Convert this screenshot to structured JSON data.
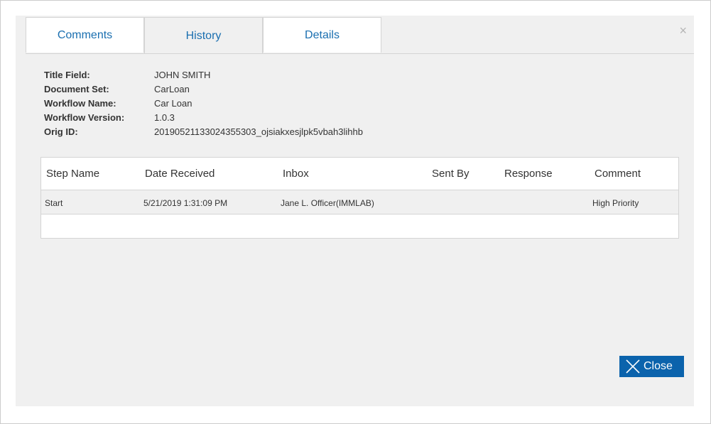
{
  "tabs": [
    {
      "label": "Comments"
    },
    {
      "label": "History"
    },
    {
      "label": "Details"
    }
  ],
  "dialog": {
    "close_symbol": "×",
    "close_button_label": "Close"
  },
  "info": [
    {
      "label": "Title Field:",
      "value": "JOHN SMITH"
    },
    {
      "label": "Document Set:",
      "value": "CarLoan"
    },
    {
      "label": "Workflow Name:",
      "value": "Car Loan"
    },
    {
      "label": "Workflow Version:",
      "value": "1.0.3"
    },
    {
      "label": "Orig ID:",
      "value": "20190521133024355303_ojsiakxesjlpk5vbah3lihhb"
    }
  ],
  "history": {
    "columns": [
      "Step Name",
      "Date Received",
      "Inbox",
      "Sent By",
      "Response",
      "Comment"
    ],
    "rows": [
      {
        "step_name": "Start",
        "date_received": "5/21/2019 1:31:09 PM",
        "inbox": "Jane L. Officer(IMMLAB)",
        "sent_by": "",
        "response": "",
        "comment": "High Priority"
      }
    ]
  },
  "colors": {
    "accent": "#0b63ac",
    "tab_text": "#1a6fb0",
    "dialog_bg": "#f0f0f0"
  },
  "icons": {
    "dialog_close": "close-icon",
    "button_close": "x-icon"
  }
}
